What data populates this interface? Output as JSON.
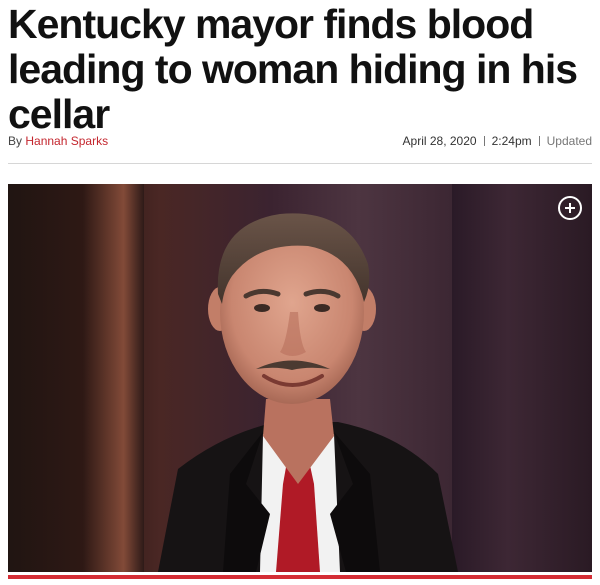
{
  "article": {
    "headline": "Kentucky mayor finds blood leading to woman hiding in his cellar",
    "byline_prefix": "By",
    "author": "Hannah Sparks",
    "date": "April 28, 2020",
    "time": "2:24pm",
    "updated_label": "Updated"
  },
  "photo": {
    "expand_icon": "plus-circle-icon"
  },
  "colors": {
    "author_link": "#c4262e",
    "accent_bar": "#d42d35"
  }
}
